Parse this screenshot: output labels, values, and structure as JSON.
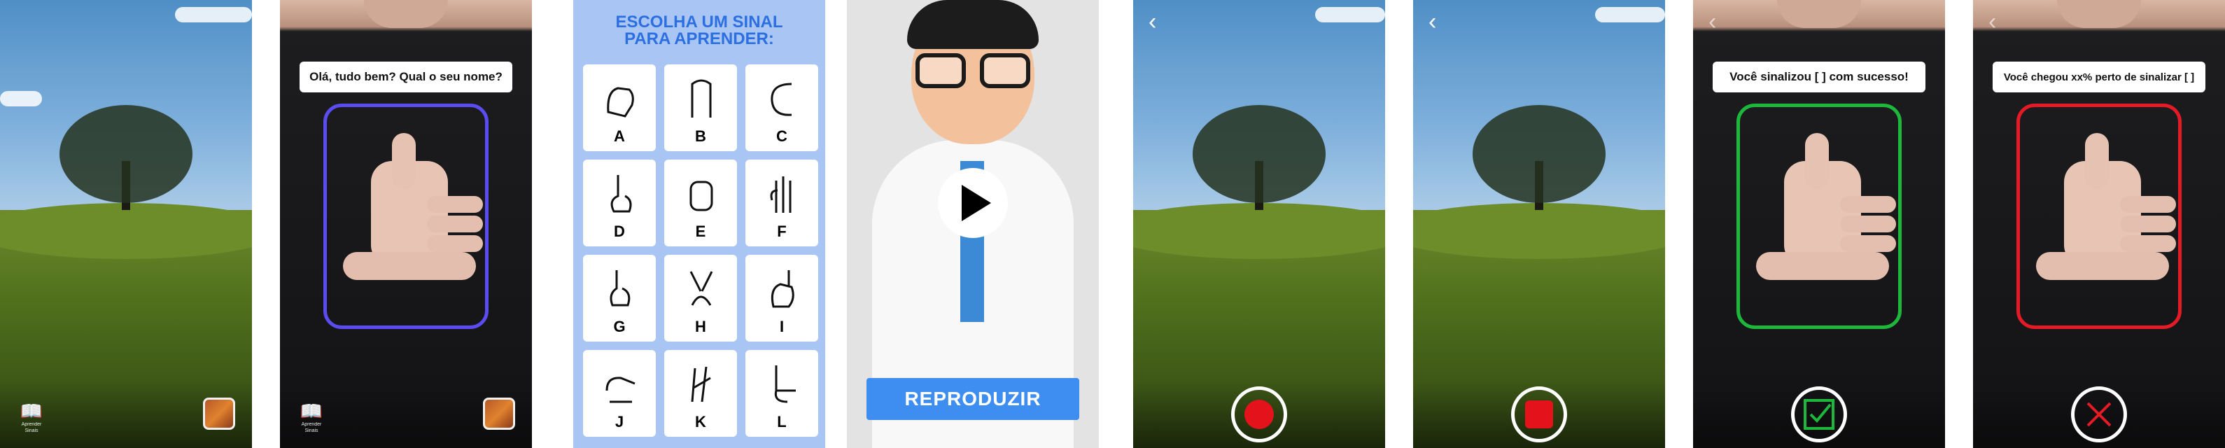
{
  "screen1": {
    "book_caption": "Aprender Sinais"
  },
  "screen2": {
    "prompt": "Olá, tudo bem? Qual o seu nome?",
    "book_caption": "Aprender Sinais"
  },
  "screen3": {
    "title_line1": "ESCOLHA UM SINAL",
    "title_line2": "PARA APRENDER:",
    "letters": [
      "A",
      "B",
      "C",
      "D",
      "E",
      "F",
      "G",
      "H",
      "I",
      "J",
      "K",
      "L"
    ]
  },
  "screen4": {
    "play_label": "REPRODUZIR"
  },
  "screen5": {
    "back_label": "‹"
  },
  "screen6": {
    "back_label": "‹"
  },
  "screen7": {
    "back_label": "‹",
    "message": "Você sinalizou [ ] com sucesso!"
  },
  "screen8": {
    "back_label": "‹",
    "message": "Você chegou xx% perto de sinalizar [ ]"
  },
  "colors": {
    "frame_purple": "#5a4cf0",
    "frame_green": "#1db83b",
    "frame_red": "#e41b26",
    "accent_blue": "#3d8ef0"
  }
}
